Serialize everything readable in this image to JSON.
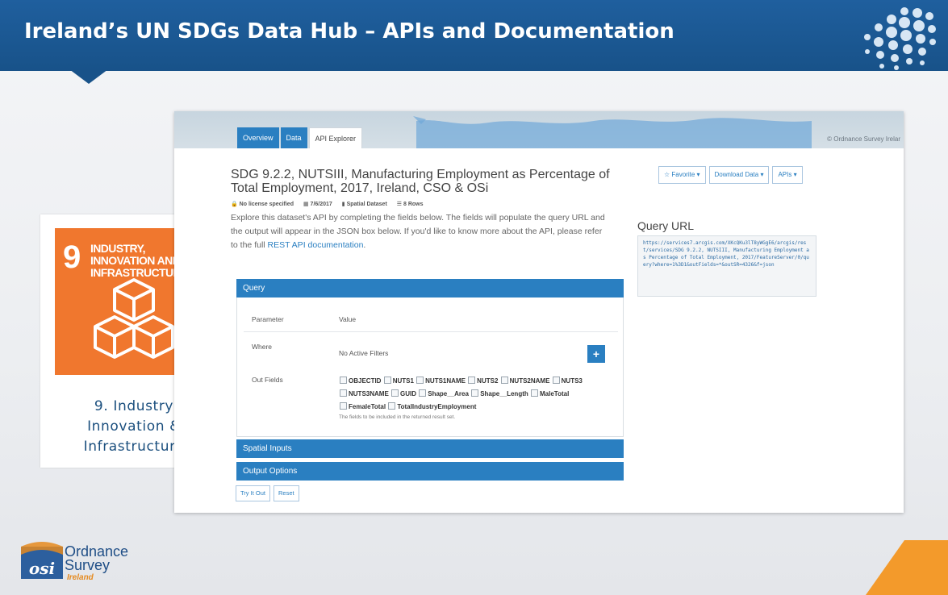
{
  "slide": {
    "title": "Ireland’s UN SDGs Data Hub – APIs and Documentation"
  },
  "sdg": {
    "number": "9",
    "label": "INDUSTRY, INNOVATION AND INFRASTRUCTURE",
    "caption_line1": "9. Industry",
    "caption_line2": "Innovation &",
    "caption_line3": "Infrastructure",
    "tile_color": "#f0772e"
  },
  "screenshot": {
    "map_credit": "© Ordnance Survey Irelar",
    "tabs": [
      {
        "label": "Overview"
      },
      {
        "label": "Data"
      },
      {
        "label": "API Explorer"
      }
    ],
    "dataset_title": "SDG 9.2.2, NUTSIII, Manufacturing Employment as Percentage of Total Employment, 2017, Ireland, CSO & OSi",
    "buttons": {
      "favorite": "☆ Favorite ▾",
      "download": "Download Data ▾",
      "apis": "APIs ▾"
    },
    "meta": {
      "license": "No license specified",
      "date": "7/6/2017",
      "type": "Spatial Dataset",
      "rows": "8 Rows"
    },
    "explore_text": "Explore this dataset's API by completing the fields below. The fields will populate the query URL and the output will appear in the JSON box below. If you'd like to know more about the API, please refer to the full ",
    "explore_link": "REST API documentation",
    "explore_end": ".",
    "query_url_title": "Query URL",
    "query_url": "https://services7.arcgis.com/XKcQKu3lT8yWGgE6/arcgis/rest/services/SDG 9.2.2, NUTSIII, Manufacturing Employment as Percentage of Total Employment, 2017/FeatureServer/0/query?where=1%3D1&outFields=*&outSR=4326&f=json",
    "query_panel": {
      "header": "Query",
      "param_label": "Parameter",
      "value_label": "Value",
      "where_label": "Where",
      "where_value": "No Active Filters",
      "plus": "+",
      "out_fields_label": "Out Fields",
      "fields": [
        "OBJECTID",
        "NUTS1",
        "NUTS1NAME",
        "NUTS2",
        "NUTS2NAME",
        "NUTS3",
        "NUTS3NAME",
        "GUID",
        "Shape__Area",
        "Shape__Length",
        "MaleTotal",
        "FemaleTotal",
        "TotalIndustryEmployment"
      ],
      "fields_help": "The fields to be included in the returned result set."
    },
    "spatial_header": "Spatial Inputs",
    "output_header": "Output Options",
    "try_button": "Try It Out",
    "reset_button": "Reset",
    "accent_color": "#2a7fc1"
  },
  "footer": {
    "logo_mark": "osi",
    "org_line1": "Ordnance",
    "org_line2": "Survey",
    "org_line3": "Ireland"
  }
}
